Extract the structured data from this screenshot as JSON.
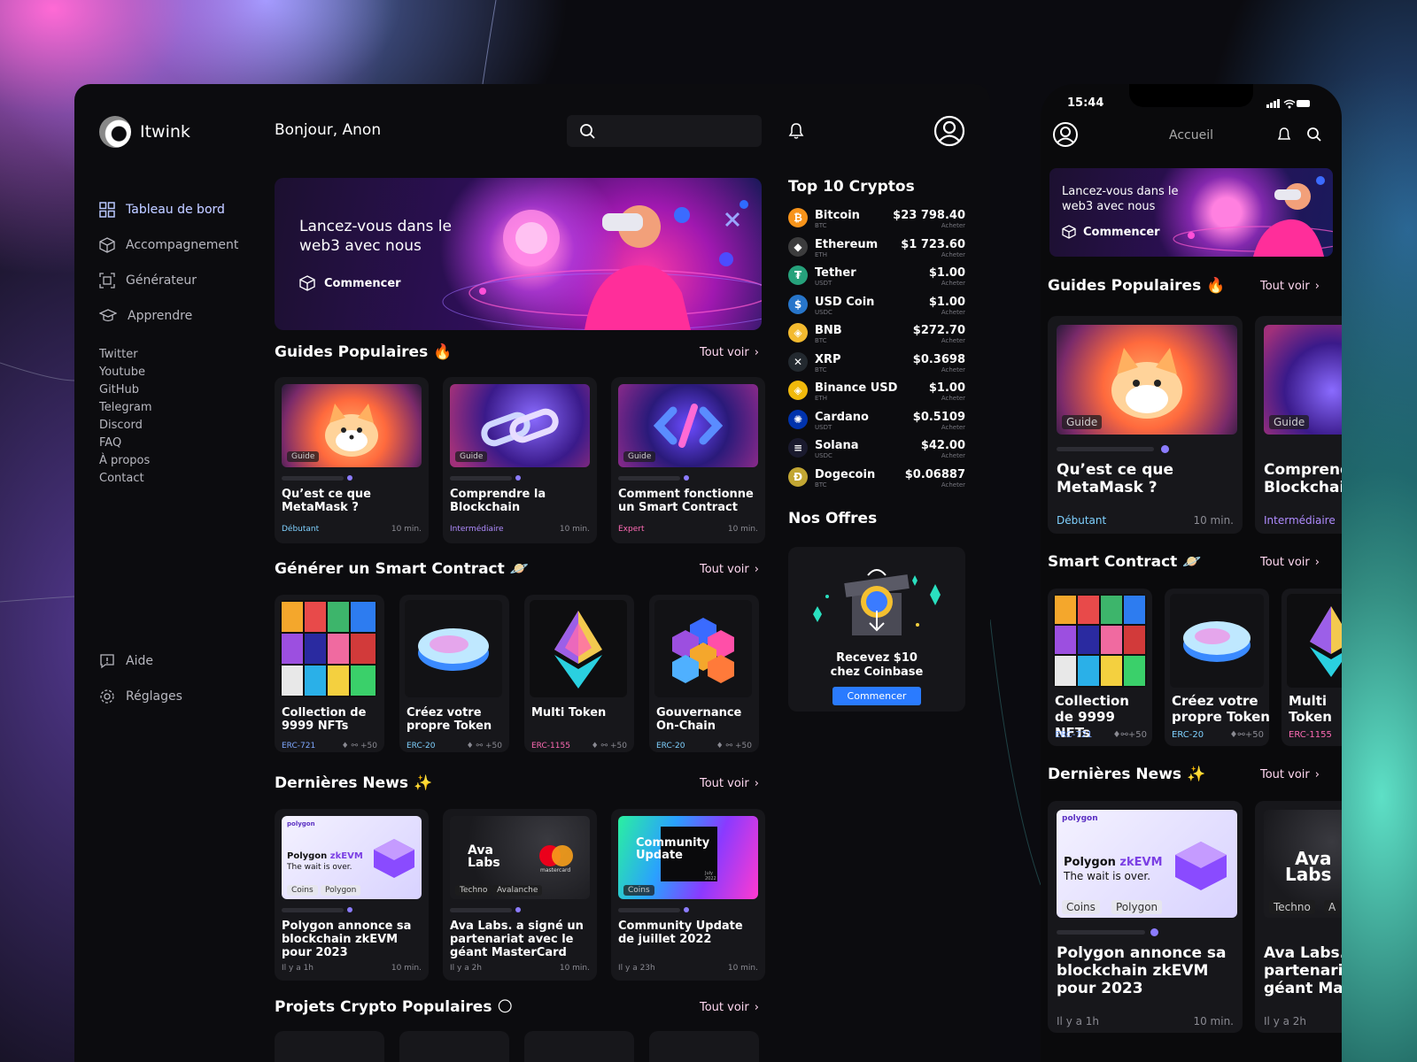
{
  "app": {
    "name": "Itwink",
    "greeting": "Bonjour, Anon"
  },
  "sidebar": {
    "items": [
      {
        "label": "Tableau de bord",
        "icon": "dashboard-icon",
        "active": true
      },
      {
        "label": "Accompagnement",
        "icon": "cube-icon"
      },
      {
        "label": "Générateur",
        "icon": "generator-icon"
      },
      {
        "label": "Apprendre",
        "icon": "graduation-cap-icon"
      }
    ],
    "links": [
      "Twitter",
      "Youtube",
      "GitHub",
      "Telegram",
      "Discord",
      "FAQ",
      "À propos",
      "Contact"
    ],
    "bottom": [
      {
        "label": "Aide",
        "icon": "help-icon"
      },
      {
        "label": "Réglages",
        "icon": "gear-icon"
      }
    ]
  },
  "hero": {
    "title": "Lancez-vous dans le web3 avec nous",
    "cta": "Commencer"
  },
  "guides": {
    "title": "Guides Populaires",
    "emoji": "🔥",
    "see_all": "Tout voir",
    "cards": [
      {
        "tag": "Guide",
        "title": "Qu’est ce que MetaMask ?",
        "level": "Débutant",
        "level_color": "#7fd1ff",
        "time": "10 min."
      },
      {
        "tag": "Guide",
        "title": "Comprendre la Blockchain",
        "level": "Intermédiaire",
        "level_color": "#b08cff",
        "time": "10 min."
      },
      {
        "tag": "Guide",
        "title": "Comment fonctionne un Smart Contract",
        "level": "Expert",
        "level_color": "#ff6bb5",
        "time": "10 min."
      }
    ]
  },
  "contracts": {
    "title": "Générer un Smart Contract",
    "emoji": "🪐",
    "see_all": "Tout voir",
    "cards": [
      {
        "title": "Collection de 9999 NFTs",
        "standard": "ERC-721",
        "count": "+50"
      },
      {
        "title": "Créez votre propre Token",
        "standard": "ERC-20",
        "count": "+50"
      },
      {
        "title": "Multi Token",
        "standard": "ERC-1155",
        "count": "+50"
      },
      {
        "title": "Gouvernance On-Chain",
        "standard": "ERC-20",
        "count": "+50"
      }
    ]
  },
  "news": {
    "title": "Dernières News",
    "emoji": "✨",
    "see_all": "Tout voir",
    "cards": [
      {
        "tags": [
          "Coins",
          "Polygon"
        ],
        "title": "Polygon annonce sa blockchain zkEVM pour 2023",
        "ago": "Il y a 1h",
        "time": "10 min.",
        "thumb": {
          "brand": "polygon",
          "line1": "Polygon",
          "line1b": "zkEVM",
          "line2": "The wait is over."
        }
      },
      {
        "tags": [
          "Techno",
          "Avalanche"
        ],
        "title": "Ava Labs. a signé un partenariat avec le géant MasterCard",
        "ago": "Il y a 2h",
        "time": "10 min.",
        "thumb": {
          "brand": "Ava",
          "brand2": "Labs",
          "sub": "mastercard"
        }
      },
      {
        "tags": [
          "Coins"
        ],
        "title": "Community Update de juillet 2022",
        "ago": "Il y a 23h",
        "time": "10 min.",
        "thumb": {
          "line1": "Community",
          "line2": "Update",
          "month": "July",
          "year": "2022"
        }
      }
    ]
  },
  "projects": {
    "title": "Projets Crypto Populaires",
    "emoji": "🌕",
    "see_all": "Tout voir"
  },
  "cryptos": {
    "title": "Top 10 Cryptos",
    "buy_label": "Acheter",
    "items": [
      {
        "name": "Bitcoin",
        "ticker": "BTC",
        "price": "$23 798.40",
        "color": "#f7931a",
        "symbol": "₿"
      },
      {
        "name": "Ethereum",
        "ticker": "ETH",
        "price": "$1 723.60",
        "color": "#3c3c3d",
        "symbol": "◆"
      },
      {
        "name": "Tether",
        "ticker": "USDT",
        "price": "$1.00",
        "color": "#26a17b",
        "symbol": "₮"
      },
      {
        "name": "USD Coin",
        "ticker": "USDC",
        "price": "$1.00",
        "color": "#2775ca",
        "symbol": "$"
      },
      {
        "name": "BNB",
        "ticker": "BTC",
        "price": "$272.70",
        "color": "#f3ba2f",
        "symbol": "◈"
      },
      {
        "name": "XRP",
        "ticker": "BTC",
        "price": "$0.3698",
        "color": "#23292f",
        "symbol": "✕"
      },
      {
        "name": "Binance USD",
        "ticker": "ETH",
        "price": "$1.00",
        "color": "#f0b90b",
        "symbol": "◈"
      },
      {
        "name": "Cardano",
        "ticker": "USDT",
        "price": "$0.5109",
        "color": "#0033ad",
        "symbol": "✺"
      },
      {
        "name": "Solana",
        "ticker": "USDC",
        "price": "$42.00",
        "color": "#1a1a2e",
        "symbol": "≡"
      },
      {
        "name": "Dogecoin",
        "ticker": "BTC",
        "price": "$0.06887",
        "color": "#c2a633",
        "symbol": "Ð"
      }
    ]
  },
  "offers": {
    "title": "Nos Offres",
    "text": "Recevez $10 chez Coinbase",
    "cta": "Commencer"
  },
  "mobile": {
    "time": "15:44",
    "title": "Accueil",
    "hero": {
      "title": "Lancez-vous dans le web3 avec nous",
      "cta": "Commencer"
    },
    "guides": {
      "title": "Guides Populaires",
      "see_all": "Tout voir",
      "cards": [
        {
          "tag": "Guide",
          "title": "Qu’est ce que MetaMask ?",
          "level": "Débutant",
          "time": "10 min."
        },
        {
          "tag": "Guide",
          "title": "Comprendre la Blockchain",
          "level": "Intermédiaire"
        }
      ]
    },
    "contracts": {
      "title": "Smart Contract",
      "see_all": "Tout voir",
      "cards": [
        {
          "title": "Collection de 9999 NFTs",
          "standard": "ERC-721",
          "count": "+50"
        },
        {
          "title": "Créez votre propre Token",
          "standard": "ERC-20",
          "count": "+50"
        },
        {
          "title": "Multi Token",
          "standard": "ERC-1155"
        }
      ]
    },
    "news": {
      "title": "Dernières News",
      "see_all": "Tout voir",
      "cards": [
        {
          "tags": [
            "Coins",
            "Polygon"
          ],
          "title": "Polygon annonce sa blockchain zkEVM pour 2023",
          "ago": "Il y a 1h",
          "time": "10 min."
        },
        {
          "tags": [
            "Techno",
            "A"
          ],
          "title": "Ava Labs. a signé un partenariat avec le géant MasterCard",
          "ago": "Il y a 2h"
        }
      ]
    }
  }
}
